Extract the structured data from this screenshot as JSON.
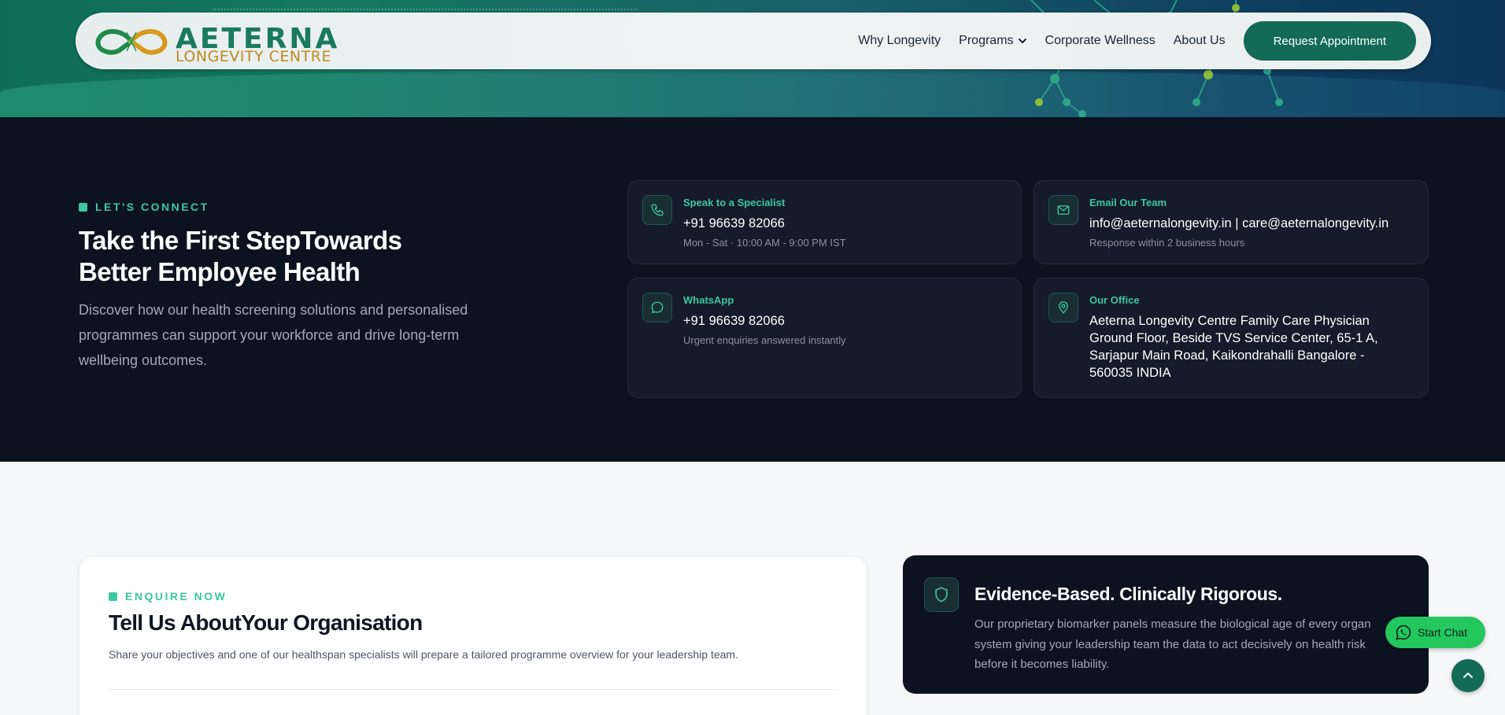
{
  "brand": {
    "title": "AETERNA",
    "subtitle": "LONGEVITY CENTRE"
  },
  "nav": {
    "items": [
      {
        "label": "Why Longevity"
      },
      {
        "label": "Programs"
      },
      {
        "label": "Corporate Wellness"
      },
      {
        "label": "About Us"
      }
    ],
    "cta": "Request Appointment"
  },
  "connect": {
    "eyebrow": "LET'S CONNECT",
    "title_line1": "Take the First StepTowards",
    "title_line2": "Better Employee Health",
    "description": "Discover how our health screening solutions and personalised programmes can support your workforce and drive long-term wellbeing outcomes."
  },
  "contacts": {
    "phone": {
      "label": "Speak to a Specialist",
      "value": "+91 96639 82066",
      "note": "Mon - Sat · 10:00 AM - 9:00 PM IST",
      "icon": "phone-icon"
    },
    "email": {
      "label": "Email Our Team",
      "value": "info@aeternalongevity.in | care@aeternalongevity.in",
      "note": "Response within 2 business hours",
      "icon": "mail-icon"
    },
    "whatsapp": {
      "label": "WhatsApp",
      "value": "+91 96639 82066",
      "note": "Urgent enquiries answered instantly",
      "icon": "chat-bubble-icon"
    },
    "office": {
      "label": "Our Office",
      "value": "Aeterna Longevity Centre Family Care Physician Ground Floor, Beside TVS Service Center, 65-1 A, Sarjapur Main Road, Kaikondrahalli Bangalore - 560035 INDIA",
      "icon": "map-pin-icon"
    }
  },
  "enquire": {
    "eyebrow": "ENQUIRE NOW",
    "title": "Tell Us AboutYour Organisation",
    "description": "Share your objectives and one of our healthspan specialists will prepare a tailored programme overview for your leadership team."
  },
  "evidence": {
    "title": "Evidence-Based. Clinically Rigorous.",
    "description": "Our proprietary biomarker panels measure the biological age of every organ system giving your leadership team the data to act decisively on health risk before it becomes liability.",
    "icon": "shield-icon"
  },
  "widgets": {
    "chat": "Start Chat"
  },
  "colors": {
    "accent": "#3cc7a0",
    "brand_green": "#136a55",
    "dark_bg": "#0c1220",
    "card_bg": "#151b2a",
    "whatsapp_green": "#23c75e"
  }
}
